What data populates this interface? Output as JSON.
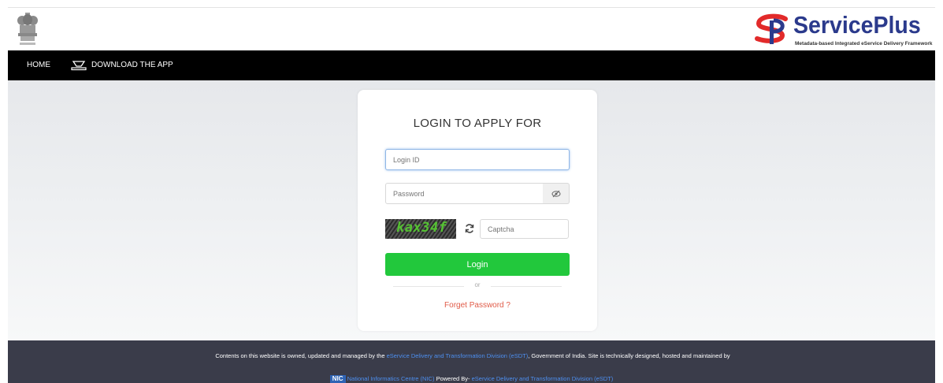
{
  "brand": {
    "name": "ServicePlus",
    "tagline": "Metadata-based Integrated eService Delivery Framework",
    "logo_color": "#e22a2a",
    "name_color": "#2b3a8c"
  },
  "nav": {
    "home": "HOME",
    "download_app": "DOWNLOAD THE APP"
  },
  "login": {
    "title": "LOGIN TO APPLY FOR",
    "login_id_placeholder": "Login ID",
    "password_placeholder": "Password",
    "captcha_text": "kax34f",
    "captcha_placeholder": "Captcha",
    "login_button": "Login",
    "or_text": "or",
    "forget_password": "Forget Password ?",
    "button_color": "#22c83c",
    "forget_color": "#e05a47"
  },
  "footer": {
    "text_before": "Contents on this website is owned, updated and managed by the ",
    "link1": "eService Delivery and Transformation Division (eSDT)",
    "text_after": ", Government of India. Site is technically designed, hosted and maintained by",
    "nic_badge": "NIC",
    "nic_link": "National Informatics Centre (NIC)",
    "powered_by": " Powered By- ",
    "powered_link": "eService Delivery and Transformation Division (eSDT)",
    "link_color": "#4d8ff0"
  }
}
